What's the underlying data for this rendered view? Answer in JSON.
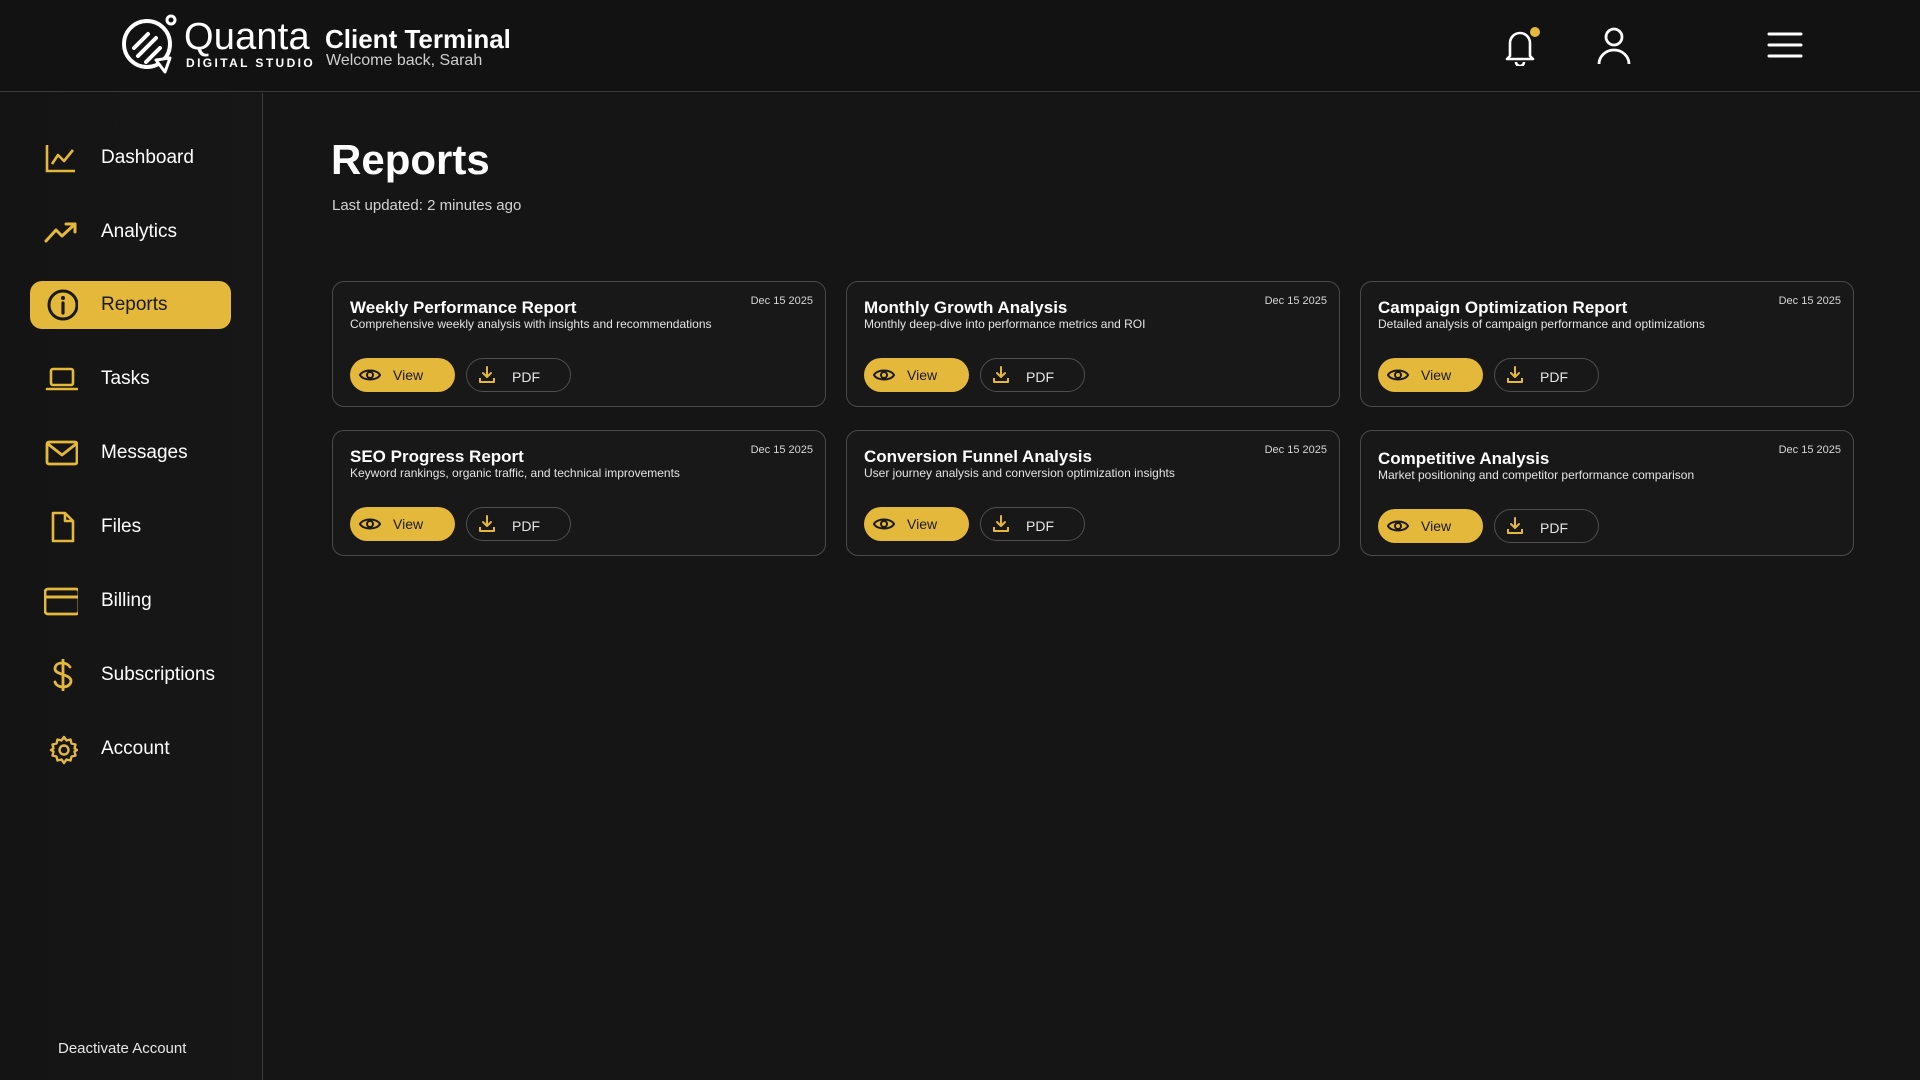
{
  "colors": {
    "accent": "#e4b83a",
    "background": "#151515",
    "border": "#4a4a4a"
  },
  "header": {
    "brand_name": "Quanta",
    "brand_sub": "DIGITAL STUDIO",
    "title": "Client Terminal",
    "subtitle": "Welcome back, Sarah",
    "icons": [
      "bell-icon",
      "user-icon",
      "menu-icon"
    ]
  },
  "sidebar": {
    "items": [
      {
        "label": "Dashboard",
        "icon": "chart-line-icon",
        "active": false
      },
      {
        "label": "Analytics",
        "icon": "trending-up-icon",
        "active": false
      },
      {
        "label": "Reports",
        "icon": "info-icon",
        "active": true
      },
      {
        "label": "Tasks",
        "icon": "laptop-icon",
        "active": false
      },
      {
        "label": "Messages",
        "icon": "mail-icon",
        "active": false
      },
      {
        "label": "Files",
        "icon": "file-icon",
        "active": false
      },
      {
        "label": "Billing",
        "icon": "credit-card-icon",
        "active": false
      },
      {
        "label": "Subscriptions",
        "icon": "dollar-icon",
        "active": false
      },
      {
        "label": "Account",
        "icon": "gear-icon",
        "active": false
      }
    ],
    "deactivate": "Deactivate Account"
  },
  "main": {
    "title": "Reports",
    "subtitle": "Last updated: 2 minutes ago",
    "cards": [
      {
        "title": "Weekly Performance Report",
        "desc": "Comprehensive weekly analysis with insights and recommendations",
        "date": "Dec 15 2025",
        "view": "View",
        "pdf": "PDF"
      },
      {
        "title": "Monthly Growth Analysis",
        "desc": "Monthly deep-dive into performance metrics and ROI",
        "date": "Dec 15 2025",
        "view": "View",
        "pdf": "PDF"
      },
      {
        "title": "Campaign Optimization Report",
        "desc": "Detailed analysis of campaign performance and optimizations",
        "date": "Dec 15 2025",
        "view": "View",
        "pdf": "PDF"
      },
      {
        "title": "SEO Progress Report",
        "desc": "Keyword rankings, organic traffic, and technical improvements",
        "date": "Dec 15 2025",
        "view": "View",
        "pdf": "PDF"
      },
      {
        "title": "Conversion Funnel Analysis",
        "desc": "User journey analysis and conversion optimization insights",
        "date": "Dec 15 2025",
        "view": "View",
        "pdf": "PDF"
      },
      {
        "title": "Competitive Analysis",
        "desc": "Market positioning and competitor performance comparison",
        "date": "Dec 15 2025",
        "view": "View",
        "pdf": "PDF"
      }
    ]
  }
}
